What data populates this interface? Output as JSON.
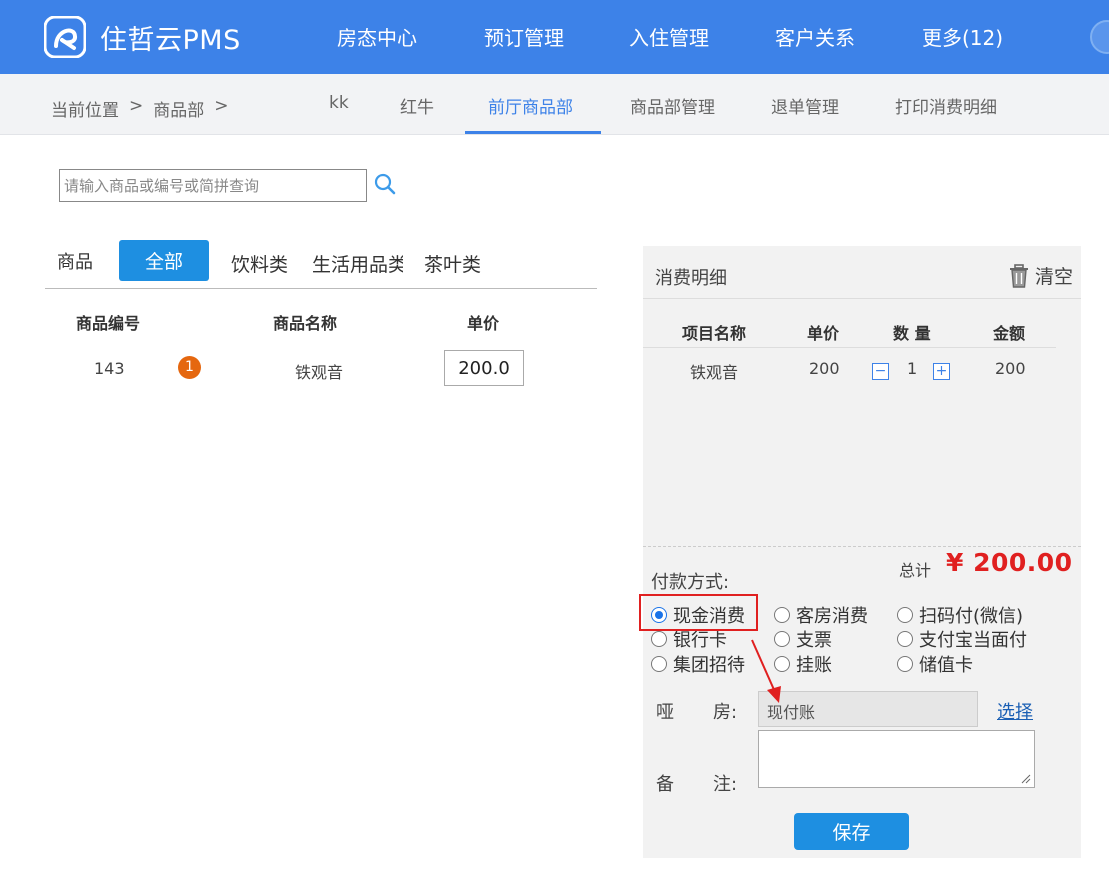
{
  "header": {
    "app_name": "住哲云PMS",
    "nav": [
      "房态中心",
      "预订管理",
      "入住管理",
      "客户关系",
      "更多(12)"
    ]
  },
  "subnav": {
    "breadcrumb_label": "当前位置",
    "breadcrumb_sep": ">",
    "breadcrumb_current": "商品部",
    "tabs": [
      "kk",
      "红牛",
      "前厅商品部",
      "商品部管理",
      "退单管理",
      "打印消费明细"
    ],
    "active_tab": "前厅商品部"
  },
  "search": {
    "placeholder": "请输入商品或编号或简拼查询",
    "value": ""
  },
  "categories": {
    "label": "商品",
    "active": "全部",
    "items": [
      "饮料类",
      "生活用品类",
      "茶叶类"
    ]
  },
  "products": {
    "headers": [
      "商品编号",
      "商品名称",
      "单价"
    ],
    "rows": [
      {
        "code": "143",
        "badge": "1",
        "name": "铁观音",
        "price": "200.0"
      }
    ]
  },
  "detail": {
    "title": "消费明细",
    "clear_label": "清空",
    "headers": [
      "项目名称",
      "单价",
      "数 量",
      "金额"
    ],
    "rows": [
      {
        "name": "铁观音",
        "price": "200",
        "qty": "1",
        "amount": "200"
      }
    ],
    "total_label": "总计",
    "total_value": "¥ 200.00"
  },
  "payment": {
    "label": "付款方式:",
    "options": [
      "现金消费",
      "客房消费",
      "扫码付(微信)",
      "银行卡",
      "支票",
      "支付宝当面付",
      "集团招待",
      "挂账",
      "储值卡"
    ],
    "selected": "现金消费"
  },
  "form": {
    "room_label_1": "哑",
    "room_label_2": "房:",
    "room_value": "现付账",
    "select_label": "选择",
    "remark_label_1": "备",
    "remark_label_2": "注:",
    "save_label": "保存"
  },
  "colors": {
    "brand": "#3d82e8",
    "button": "#1e8fe1",
    "total": "#e02020",
    "badge": "#e5670f",
    "annotation": "#e02020"
  }
}
